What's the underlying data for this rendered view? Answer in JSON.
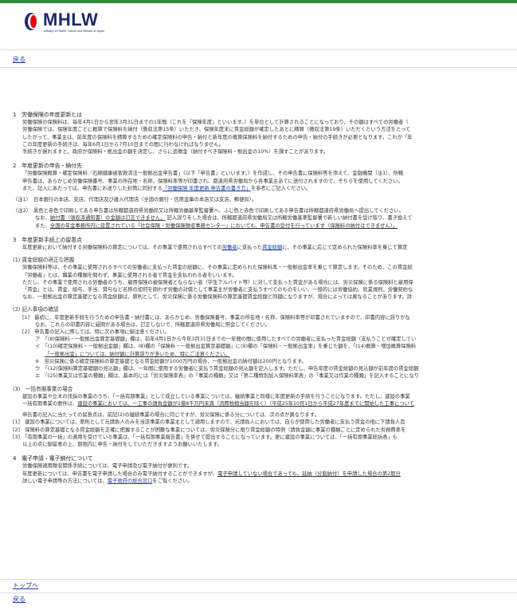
{
  "header": {
    "logo_text": "MHLW",
    "logo_subtext": "Ministry of Health, Labour and Welfare of Japan"
  },
  "nav": {
    "back_top": "戻る",
    "to_top": "トップへ",
    "back_bottom": "戻る"
  },
  "colors": {
    "top_bar": "#2f8a3a",
    "link": "#1a3ea0",
    "logo": "#1d2a6b",
    "logo_red": "#e60012"
  },
  "content": {
    "s1": {
      "title": "1　労働保険の年度更新とは",
      "l1": "労働保険の保険料は、毎年4月1日から翌年3月31日までの1年間（これを「保険年度」といいます。）を単位として計算されることになっており、その額はすべての労働者（",
      "l2": "労働保険では、保険年度ごとに概算で保険料を納付（徴収法第15条）いただき、保険年度末に賃金総額が確定したあとに精算（徴収法第19条）いただくという方法をとって",
      "l3": "したがって、事業主は、前年度の保険料を精算するための確定保険料の申告・納付と新年度の概算保険料を納付するための申告・納付の手続きが必要となります。これが「年",
      "l4": "この年度更新の手続きは、毎年6月1日から7月10日までの間に行わなければなりません。",
      "l5": "手続きが遅れますと、政府が保険料・拠出金の額を決定し、さらに追徴金（納付すべき保険料・拠出金の10%）を課すことがあります。"
    },
    "s2": {
      "title": "2　年度更新の申告・納付先",
      "l1": "「労働保険概算・確定保険料／石綿健康被害救済法一般拠出金申告書」（以下「申告書」といいます。）を作成し、その申告書に保険料等を添えて、金融機関（注1）、所轄",
      "l2": "申告書は、あらかじめ労働保険番号、事業の所在地・名称、保険料率等が印書され、都道府県労働局から各事業主あてに送付されますので、そちらを使用してください。",
      "l3a": "また、記入にあたっては、申告書にお送りした封筒に同封する",
      "l3_link": "「労働保険 年度更新 申告書の書き方」",
      "l3b": "を参考にご記入ください。",
      "n1": "（注1）　日本銀行の本店、支店、代理店及び歳入代理店（全国の銀行・信用金庫の本店又は支店、郵便局）。",
      "n2": "（注2）　黒色と赤色で印刷してある申告書は所轄都道府県労働局又は所轄労働基準監督署へ、ふじ色と赤色で印刷してある申告書は所轄都道府県労働局へ提出してください。",
      "n2b_a": "なお、",
      "n2b_u": "納付書（領収済通知書）の金額は訂正できません。",
      "n2b_b": " 記入誤りをした場合は、所轄都道府県労働局又は所轄労働基準監督署で新しい納付書を受け取り、書き換えて",
      "n2c_a": "また、",
      "n2c_u": "全国の年金事務所内に設置されている「社会保険・労働保険徴収事務センター」においても、申告書の受付を行っています（保険料の納付はできません）。"
    },
    "s3": {
      "title": "3　年度更新手続上の留意点",
      "intro_a": "年度更新において納付する労働保険料の算定については、その事業で使用されるすべての",
      "intro_l1": "労働者",
      "intro_b": "に支払った",
      "intro_l2": "賃金総額",
      "intro_c": "に、その事業に応じて定められた保険料率を乗じて算定",
      "sub1": {
        "title": "(1) 賃金総額の適正な把握",
        "l1": "労働保険料等は、その事業に使用されるすべての労働者に支払った賃金の総額に、その事業に定められた保険料率・一般拠出金率を乗じて算定します。そのため、この賃金総",
        "l2": "「労働者」とは、職業の種類を問わず、事業に使用される者で賃金を支払われる者をいいます。",
        "l3": "ただし、その事業で使用される労働者のうち、雇用保険の被保険者とならない者（学生アルバイト等）に対して支払った賃金がある場合には、労災保険に係る保険料と雇用保",
        "l4": "「賃金」とは、賃金、給与、手当、賞与など名称の如何を問わず労働の対償として事業主が労働者に支払うすべてのものをいい、一般的には労働協約、就業規則、労働契約な",
        "l5": "なお、一般拠出金の算定基礎となる賃金総額は、原則として、労災保険に係る労働保険料の算定基礎賃金総額と同額になりますが、場合によっては異なることがあります。詳"
      },
      "sub2": {
        "title": "(2) 記入事項の確認",
        "r1": "[1]　最初に、年度更新手続を行うための申告書・納付書には、あらかじめ、労働保険番号、事業の所在地・名称、保険料率等が印書されていますので、印書内容に誤りがな",
        "r1b": "なお、これらの印書内容に疑問がある場合は、訂正しないで、所轄都道府県労働局に照会してください。",
        "r2": "[2]　申告書の記入に際しては、特に次の事項に御注意ください。",
        "a": "ア　「(8)保険料・一般拠出金算定基礎額」欄は、前年4月1日から今年3月31日までの一年間の間に使用したすべての労働者に支払った賃金総額（支払うことが確定してい",
        "i": "イ　「(10)確定保険料・一般拠出金額」欄は、(8)欄の「保険料・一般拠出金算定基礎額」に(9)欄の「保険料・一般拠出金率」を乗じた額を、「(14)概算・増加概算保険料",
        "i2": "「一般拠出金」については、納付額に計算誤りが多いため、特にご注意ください。",
        "kome": "※　労災保険に係る確定保険料の算定基礎となる賃金総額が1000万円の場合、一般拠出金の納付額は200円となります。",
        "u": "ウ　「(12)保険料算定基礎額の見込額」欄は、一年間に使用する労働者に支払う賃金総額の見込額を記入します。ただし、申告年度の賃金総額の見込額が前年度の賃金総額",
        "e": "エ　「(25)事業又は作業の種類」欄は、基本的には「労災保険率表」の「事業の種類」又は「第二種特別加入保険料率表」の「事業又は作業の種類」を記入することになり"
      },
      "sub3": {
        "title": "(3)　一括有期事業の場合",
        "l1": "建設の事業や立木の伐採の事業のうち、「一括有期事業」として成立している事業については、継続事業と同様に年度更新の手続を行うことになります。ただし、建設の事業",
        "l2a": "一括有期事業の要件は、",
        "l2u": "建設の事業においては、一工事の請負金額が1億8千万円未満（消費税相当額を除く）（平成25年10月1日から平成27年度までに開始した工事について",
        "l3": "申告書の記入に当たっての留意点は、前記(2)の継続事業の場合に同じですが、労災保険に係る分については、次の点が異なります。",
        "b1": "[1]　建設の事業については、原則として元請負人のみを当該事業の事業主として適用しますので、元請負人においては、自らが使用した労働者に支払う賃金の他に下請負人及",
        "b2": "[2]　保険料の算定基礎となる賃金総額を正確に把握することが困難な事業については、労災保険分に限り賃金総額の特例（請負金額に事業の種類ごとに定められた労務費率を",
        "b3": "[3]　「有期事業の一括」の適用を受けている事業は、「一括有期事業報告書」を併せて提出することになっています。更に建設の事業については、「一括有期事業総括表」も",
        "b4": "以上の点に御留意の上、期限内に申告・納付をしていただきますようお願いいたします。"
      }
    },
    "s4": {
      "title": "4　電子申請・電子納付について",
      "l1": "労働保険適用徴収関係手続については、電子申請及び電子納付が便利です。",
      "l2a": "年度更新については、申告書を電子申請した場合のみ電子納付することができますが、",
      "l2u": "電子申請していない場合であっても、延納（分割納付）を申請した場合の第2期分",
      "l3a": "詳しい電子申請等の方法については、",
      "l3_link": "電子政府の総合窓口",
      "l3b": "をご覧ください。"
    }
  }
}
